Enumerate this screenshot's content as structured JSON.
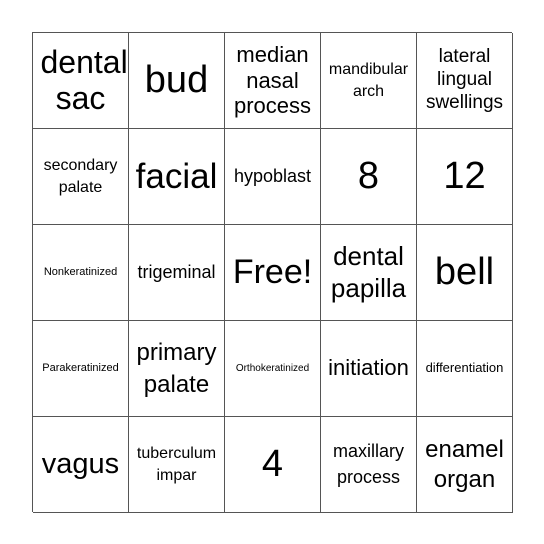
{
  "board": {
    "cells": [
      "dental sac",
      "bud",
      "median nasal process",
      "mandibular arch",
      "lateral lingual swellings",
      "secondary palate",
      "facial",
      "hypoblast",
      "8",
      "12",
      "Nonkeratinized",
      "trigeminal",
      "Free!",
      "dental papilla",
      "bell",
      "Parakeratinized",
      "primary palate",
      "Orthokeratinized",
      "initiation",
      "differentiation",
      "vagus",
      "tuberculum impar",
      "4",
      "maxillary process",
      "enamel organ"
    ],
    "free_space": "Free!"
  }
}
